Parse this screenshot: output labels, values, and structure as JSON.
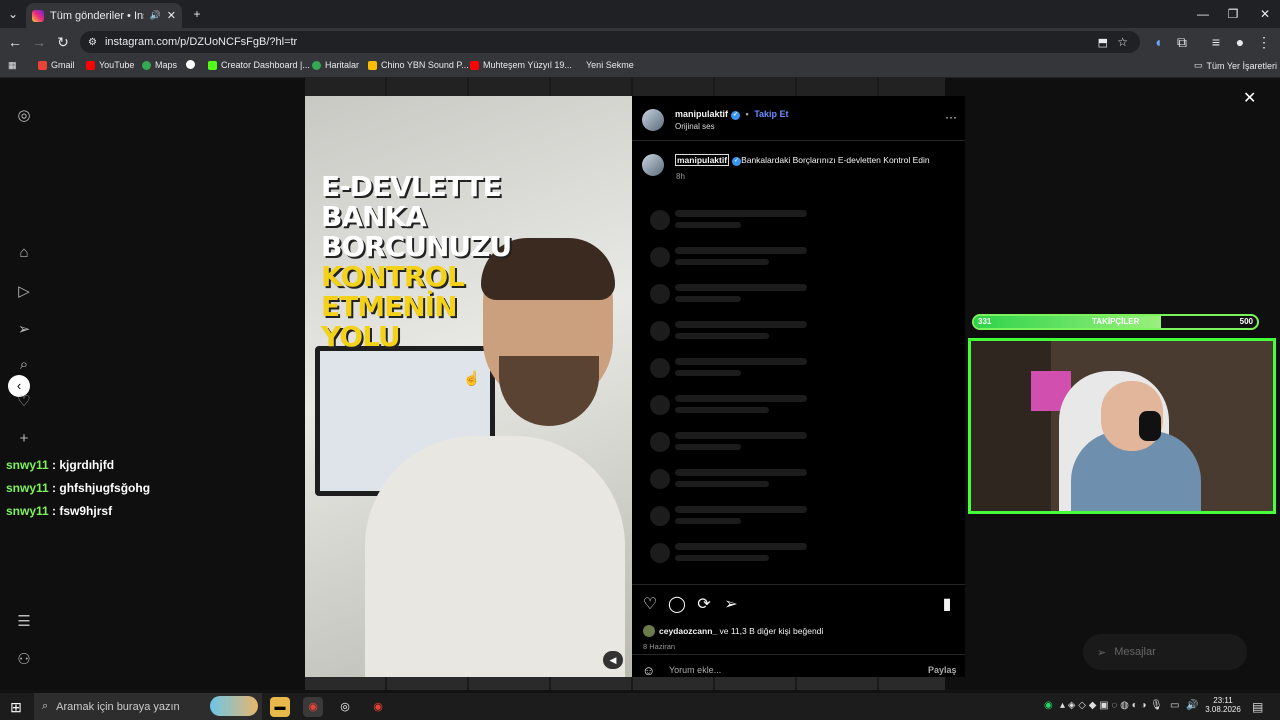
{
  "browser": {
    "tab_title": "Tüm gönderiler • Instagram",
    "url": "instagram.com/p/DZUoNCFsFgB/?hl=tr",
    "bookmarks": [
      "Gmail",
      "YouTube",
      "Maps",
      "Creator Dashboard |...",
      "Haritalar",
      "Chino YBN Sound P...",
      "Muhteşem Yüzyıl 19...",
      "Yeni Sekme"
    ],
    "all_bookmarks": "Tüm Yer İşaretleri"
  },
  "chat": [
    {
      "user": "snwy11",
      "message": ": kjgrdıhjfd"
    },
    {
      "user": "snwy11",
      "message": ": ghfshjugfsğohg"
    },
    {
      "user": "snwy11",
      "message": ": fsw9hjrsf"
    }
  ],
  "video": {
    "lines": [
      {
        "text": "E-DEVLETTE",
        "color": "#ffffff"
      },
      {
        "text": "BANKA",
        "color": "#ffffff"
      },
      {
        "text": "BORCUNUZU",
        "color": "#ffffff"
      },
      {
        "text": "KONTROL",
        "color": "#f4d21a"
      },
      {
        "text": "ETMENİN",
        "color": "#f4d21a"
      },
      {
        "text": "YOLU",
        "color": "#f4d21a"
      }
    ]
  },
  "post": {
    "username": "manipulaktif",
    "follow": "Takip Et",
    "audio": "Orijinal ses",
    "caption": "Bankalardaki Borçlarınızı E-devletten Kontrol Edin",
    "caption_time": "8h",
    "likes_user": "ceydaozcann_",
    "likes_rest": "ve 11,3 B diğer kişi beğendi",
    "date": "8 Haziran",
    "comment_placeholder": "Yorum ekle...",
    "share": "Paylaş"
  },
  "overlay": {
    "followers_current": "331",
    "followers_label": "TAKİPÇİLER",
    "followers_goal": "500",
    "followers_progress": 0.66,
    "messages": "Mesajlar"
  },
  "taskbar": {
    "search": "Aramak için buraya yazın",
    "time": "23:11",
    "date": "3.08.2026"
  }
}
